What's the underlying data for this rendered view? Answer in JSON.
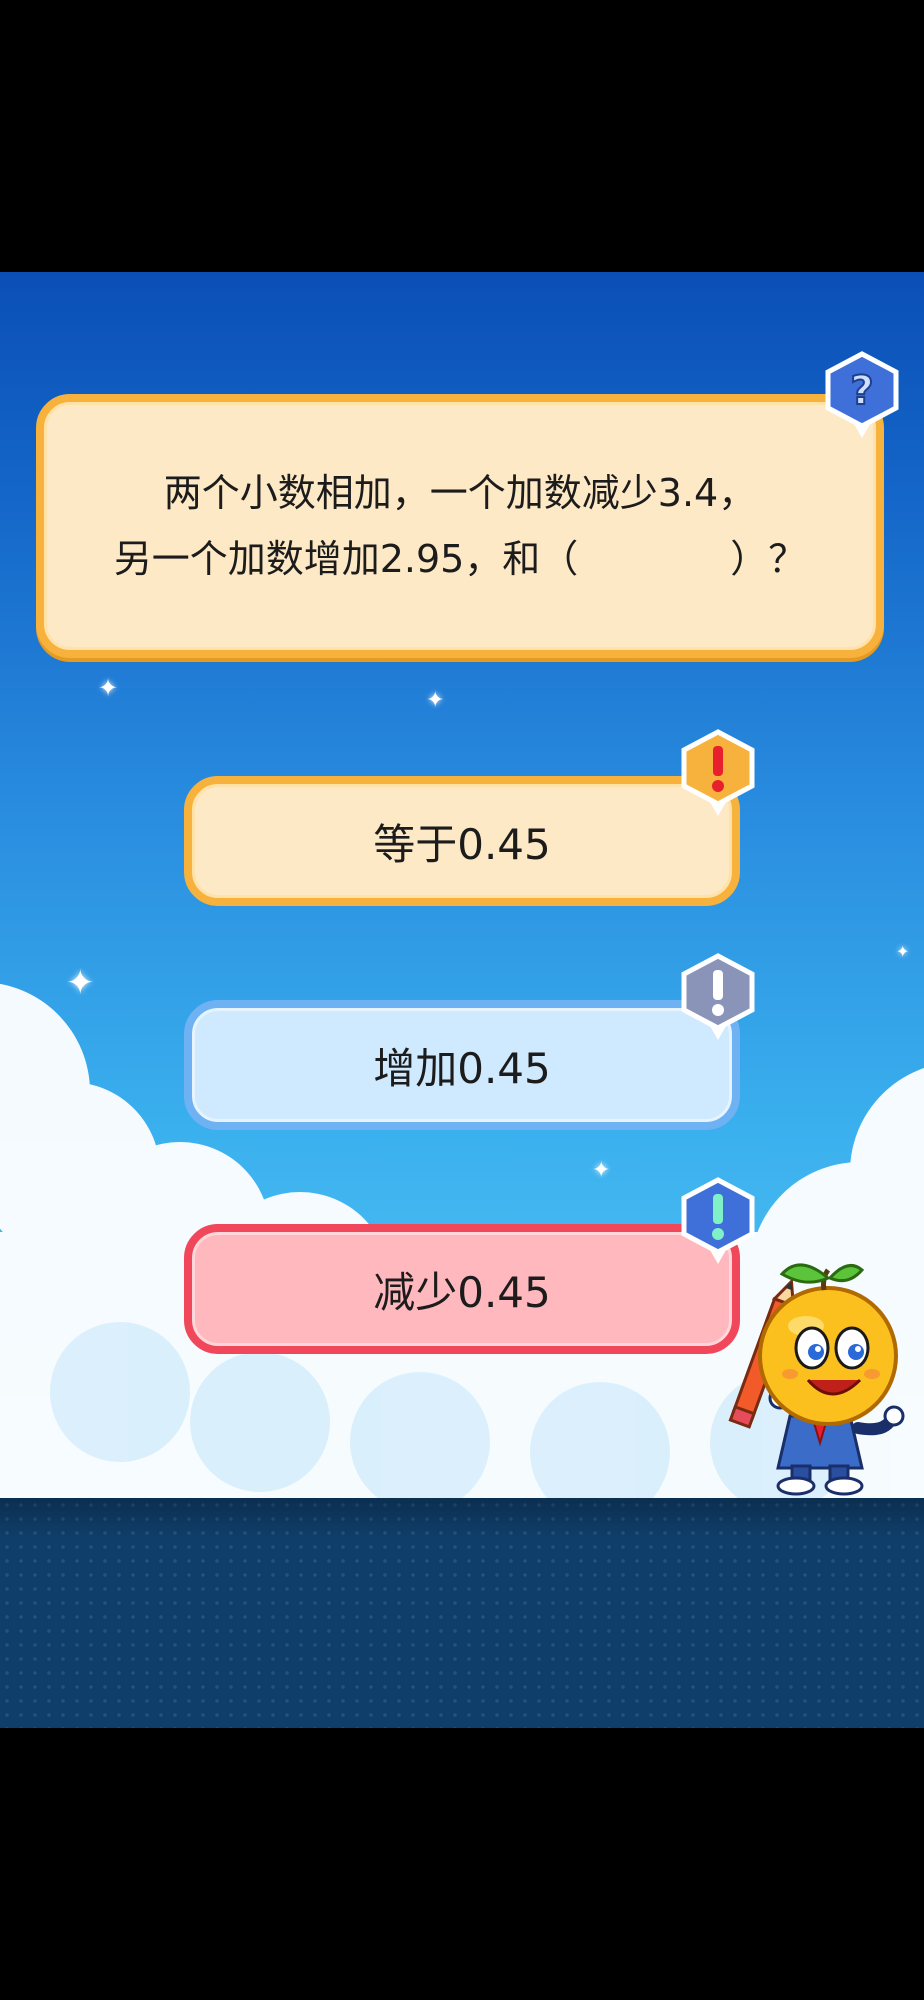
{
  "question": {
    "line1": "两个小数相加，一个加数减少3.4，",
    "line2": "另一个加数增加2.95，和（　　　　）？",
    "badge_icon": "question-mark-icon"
  },
  "answers": [
    {
      "label": "等于0.45",
      "state": "default",
      "badge_icon": "exclamation-icon",
      "badge_color": "#f7b23d"
    },
    {
      "label": "增加0.45",
      "state": "default",
      "badge_icon": "exclamation-icon",
      "badge_color": "#8a94b8"
    },
    {
      "label": "减少0.45",
      "state": "selected-wrong",
      "badge_icon": "exclamation-icon",
      "badge_color": "#3f6fd8"
    }
  ],
  "colors": {
    "sky_top": "#0b4fb6",
    "sky_bottom": "#5cc8f4",
    "orange_border": "#f7b23d",
    "blue_border": "#6fb2f4",
    "red_border": "#f0485a",
    "floor": "#0f3e6a"
  },
  "mascot": "orange-fruit-mascot-with-pencil"
}
